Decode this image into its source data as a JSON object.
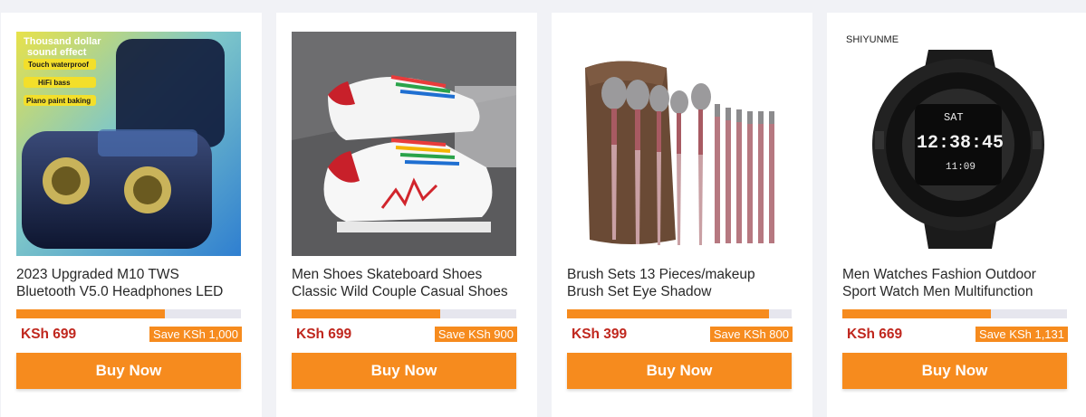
{
  "colors": {
    "accent": "#f68b1e",
    "price": "#c0271e",
    "page_bg": "#f1f2f6"
  },
  "products": [
    {
      "title": "2023 Upgraded M10 TWS\nBluetooth V5.0 Headphones LED",
      "price": "KSh 699",
      "save": "Save KSh 1,000",
      "buy_label": "Buy Now",
      "stock_fraction": 0.66,
      "image_text": {
        "line1": "Thousand dollar",
        "line2": "sound effect",
        "badge1": "Touch waterproof",
        "badge2": "HiFi bass",
        "badge3": "Piano paint baking"
      }
    },
    {
      "title": "Men Shoes Skateboard Shoes\nClassic Wild Couple Casual Shoes",
      "price": "KSh 699",
      "save": "Save KSh 900",
      "buy_label": "Buy Now",
      "stock_fraction": 0.66
    },
    {
      "title": "Brush Sets 13 Pieces/makeup\nBrush Set Eye Shadow",
      "price": "KSh 399",
      "save": "Save KSh 800",
      "buy_label": "Buy Now",
      "stock_fraction": 0.9
    },
    {
      "title": "Men Watches Fashion Outdoor\nSport Watch Men Multifunction",
      "price": "KSh 669",
      "save": "Save KSh 1,131",
      "buy_label": "Buy Now",
      "stock_fraction": 0.66,
      "image_text": {
        "brand": "SHIYUNME",
        "watch_top": "SAT",
        "watch_main": "12:38:45",
        "watch_bottom": "11:09"
      }
    }
  ]
}
